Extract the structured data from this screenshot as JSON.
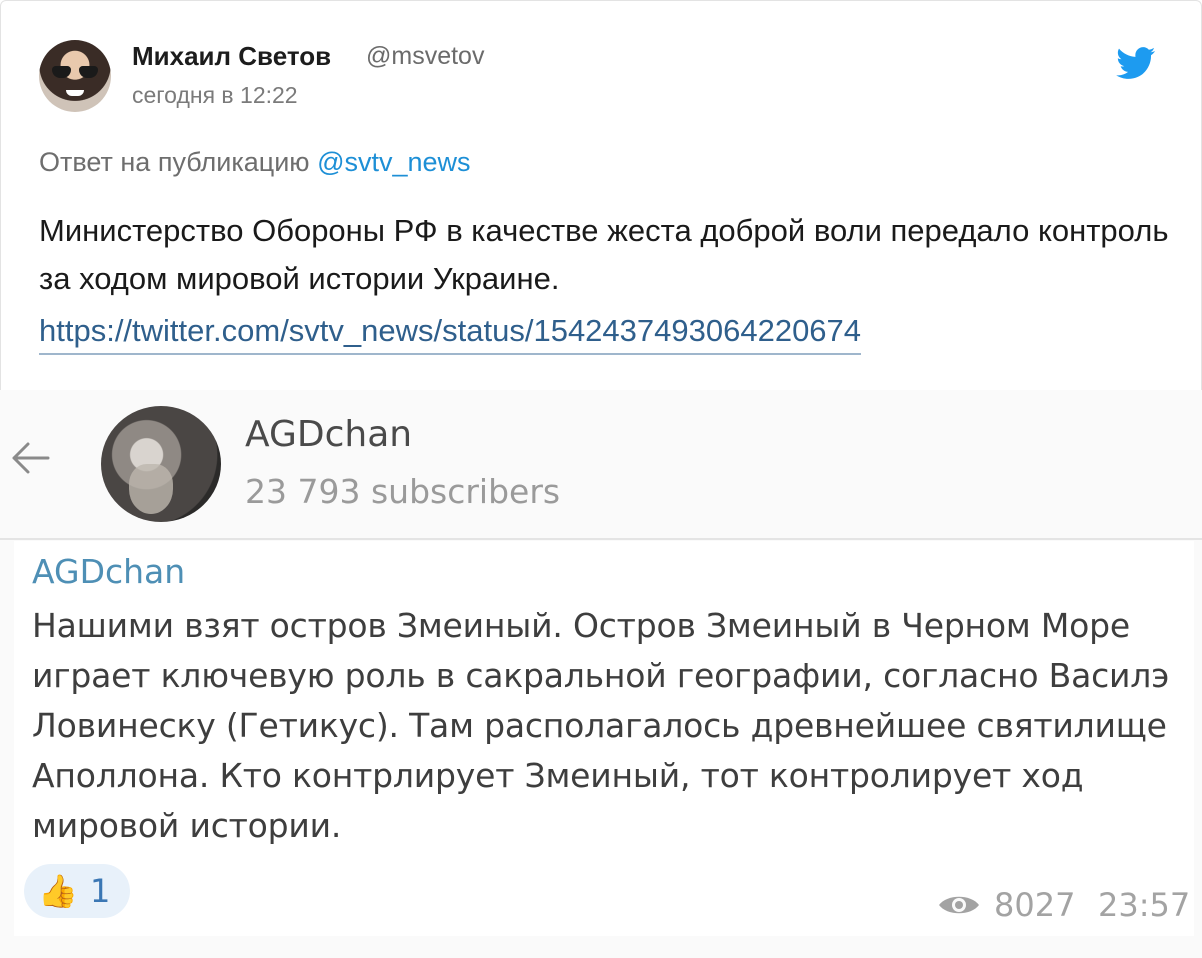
{
  "tweet": {
    "author_name": "Михаил Светов",
    "author_handle": "@msvetov",
    "timestamp": "сегодня в 12:22",
    "reply_prefix": "Ответ на публикацию ",
    "reply_to": "@svtv_news",
    "text": "Министерство Обороны РФ в качестве жеста доброй воли передало контроль за ходом мировой истории Украине.",
    "link": "https://twitter.com/svtv_news/status/1542437493064220674",
    "brand_icon": "twitter-bird-icon",
    "colors": {
      "brand": "#1d9bf0",
      "link": "#1d8fd6"
    }
  },
  "embedded": {
    "channel_name": "AGDchan",
    "subscribers": "23 793 subscribers",
    "message": {
      "author": "AGDchan",
      "text": "Нашими взят остров Змеиный. Остров Змеиный в Черном Море играет ключевую роль в сакральной географии, согласно Василэ Ловинеску (Гетикус). Там располагалось древнейшее святилище Аполлона. Кто контрлирует Змеиный, тот контролирует ход мировой истории.",
      "reaction_emoji": "👍",
      "reaction_count": "1",
      "views": "8027",
      "time": "23:57"
    }
  }
}
